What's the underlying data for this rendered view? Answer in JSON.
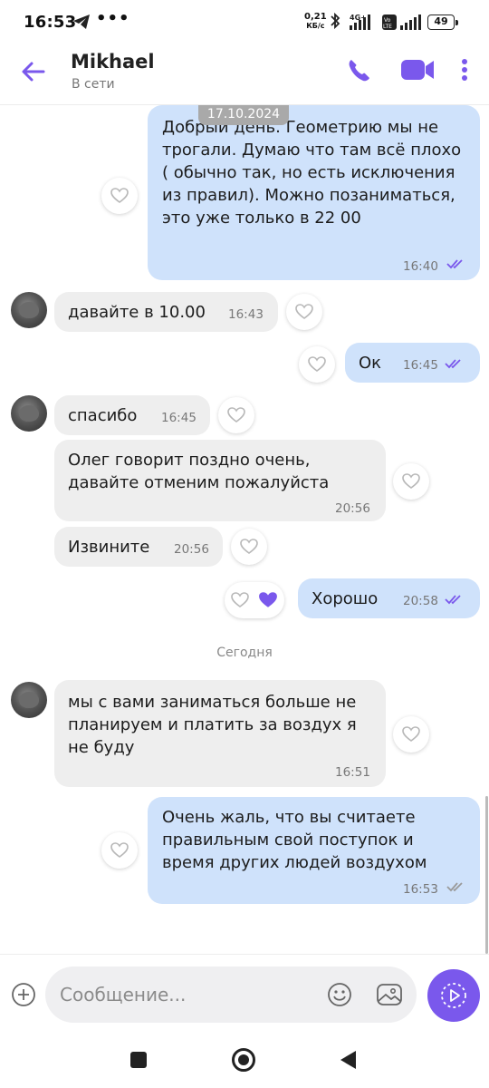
{
  "status_bar": {
    "time": "16:53",
    "speed_value": "0,21",
    "speed_unit": "КБ/с",
    "network": "4G+",
    "battery": "49"
  },
  "header": {
    "contact_name": "Mikhael",
    "contact_status": "В сети"
  },
  "chat": {
    "top_date": "17.10.2024",
    "today_label": "Сегодня",
    "messages": [
      {
        "dir": "out",
        "text": "Добрый день. Геометрию мы не трогали. Думаю что там всё плохо ( обычно так, но есть исключения из правил). Можно позаниматься, это уже только в 22 00",
        "time": "16:40",
        "status": "read"
      },
      {
        "dir": "in",
        "text": "давайте в 10.00",
        "time": "16:43"
      },
      {
        "dir": "out",
        "text": "Ок",
        "time": "16:45",
        "status": "read"
      },
      {
        "dir": "in",
        "text": "спасибо",
        "time": "16:45"
      },
      {
        "dir": "in",
        "text": "Олег говорит поздно очень, давайте отменим пожалуйста",
        "time": "20:56"
      },
      {
        "dir": "in",
        "text": "Извините",
        "time": "20:56"
      },
      {
        "dir": "out",
        "text": "Хорошо",
        "time": "20:58",
        "status": "read",
        "reaction": "liked"
      },
      {
        "dir": "in",
        "text": "мы с вами заниматься больше не планируем и платить за воздух я не буду",
        "time": "16:51"
      },
      {
        "dir": "out",
        "text": "Очень жаль, что вы считаете правильным свой поступок и время других людей воздухом",
        "time": "16:53",
        "status": "delivered"
      }
    ]
  },
  "composer": {
    "placeholder": "Сообщение..."
  },
  "colors": {
    "accent": "#7a58ec",
    "outgoing_bubble": "#cfe2fb",
    "incoming_bubble": "#eeeeee"
  },
  "icons": [
    "back-arrow-icon",
    "phone-icon",
    "video-icon",
    "more-icon",
    "heart-icon",
    "double-check-icon",
    "plus-icon",
    "emoji-icon",
    "gallery-icon",
    "voice-send-icon"
  ]
}
